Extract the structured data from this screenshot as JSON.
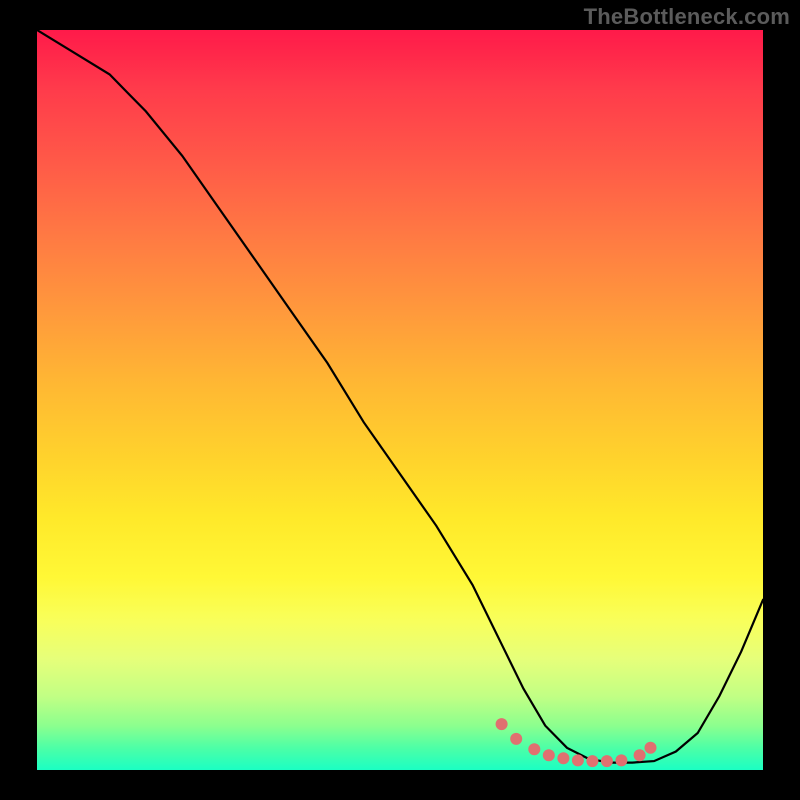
{
  "watermark": "TheBottleneck.com",
  "chart_data": {
    "type": "line",
    "title": "",
    "xlabel": "",
    "ylabel": "",
    "xlim": [
      0,
      100
    ],
    "ylim": [
      0,
      100
    ],
    "series": [
      {
        "name": "curve",
        "x": [
          0,
          5,
          10,
          15,
          20,
          25,
          30,
          35,
          40,
          45,
          50,
          55,
          60,
          64,
          67,
          70,
          73,
          76,
          79,
          82,
          85,
          88,
          91,
          94,
          97,
          100
        ],
        "values": [
          100,
          97,
          94,
          89,
          83,
          76,
          69,
          62,
          55,
          47,
          40,
          33,
          25,
          17,
          11,
          6,
          3,
          1.5,
          1,
          1,
          1.2,
          2.5,
          5,
          10,
          16,
          23
        ]
      }
    ],
    "markers": {
      "name": "bottom-dots",
      "color": "#e07070",
      "x": [
        64,
        66,
        68.5,
        70.5,
        72.5,
        74.5,
        76.5,
        78.5,
        80.5,
        83,
        84.5
      ],
      "values": [
        6.2,
        4.2,
        2.8,
        2.0,
        1.6,
        1.3,
        1.2,
        1.2,
        1.3,
        2.0,
        3.0
      ]
    },
    "gradient_stops": [
      {
        "pos": 0,
        "color": "#ff1a4a"
      },
      {
        "pos": 50,
        "color": "#ffc92d"
      },
      {
        "pos": 80,
        "color": "#f8ff5c"
      },
      {
        "pos": 100,
        "color": "#1bffc3"
      }
    ]
  }
}
